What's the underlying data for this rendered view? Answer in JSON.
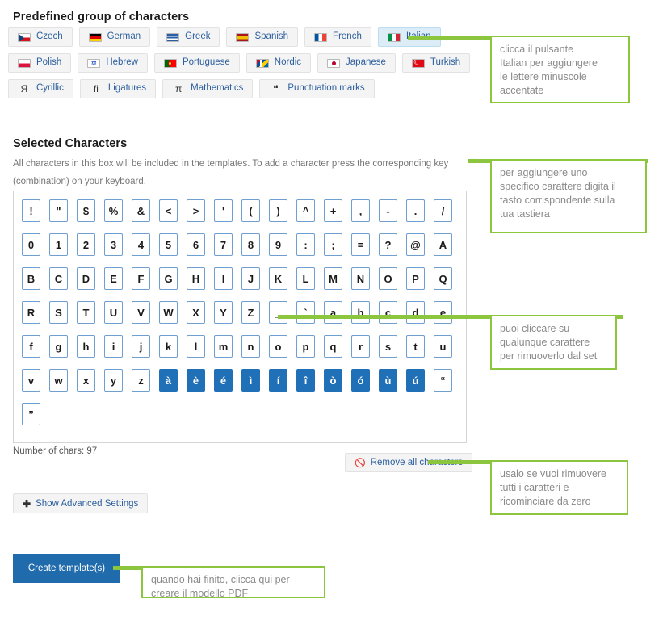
{
  "predefined": {
    "title": "Predefined group of characters",
    "rows": [
      [
        {
          "label": "Czech",
          "icon": "flag-czech-icon",
          "flag": "f-cz",
          "selected": false
        },
        {
          "label": "German",
          "icon": "flag-german-icon",
          "flag": "f-de",
          "selected": false
        },
        {
          "label": "Greek",
          "icon": "flag-greek-icon",
          "flag": "f-gr",
          "selected": false
        },
        {
          "label": "Spanish",
          "icon": "flag-spanish-icon",
          "flag": "f-es",
          "selected": false
        },
        {
          "label": "French",
          "icon": "flag-french-icon",
          "flag": "f-fr",
          "selected": false
        },
        {
          "label": "Italian",
          "icon": "flag-italian-icon",
          "flag": "f-it",
          "selected": true
        }
      ],
      [
        {
          "label": "Polish",
          "icon": "flag-polish-icon",
          "flag": "f-pl",
          "selected": false
        },
        {
          "label": "Hebrew",
          "icon": "flag-hebrew-icon",
          "flag": "f-il",
          "selected": false
        },
        {
          "label": "Portuguese",
          "icon": "flag-portuguese-icon",
          "flag": "f-pt",
          "selected": false
        },
        {
          "label": "Nordic",
          "icon": "flag-nordic-icon",
          "flag": "f-nordic",
          "selected": false
        },
        {
          "label": "Japanese",
          "icon": "flag-japanese-icon",
          "flag": "f-jp",
          "selected": false
        },
        {
          "label": "Turkish",
          "icon": "flag-turkish-icon",
          "flag": "f-tr",
          "selected": false
        }
      ],
      [
        {
          "label": "Cyrillic",
          "icon": "cyrillic-ya-icon",
          "glyph": "Я",
          "selected": false
        },
        {
          "label": "Ligatures",
          "icon": "ligature-fi-icon",
          "glyph": "ﬁ",
          "selected": false
        },
        {
          "label": "Mathematics",
          "icon": "pi-icon",
          "glyph": "π",
          "selected": false
        },
        {
          "label": "Punctuation marks",
          "icon": "quote-marks-icon",
          "glyph": "❝",
          "selected": false
        }
      ]
    ]
  },
  "selected_characters": {
    "title": "Selected Characters",
    "help_text": "All characters in this box will be included in the templates. To add a character press the corresponding key (combination) on your keyboard.",
    "count_label": "Number of chars: 97",
    "rows": [
      [
        {
          "ch": "!",
          "hl": false
        },
        {
          "ch": "\"",
          "hl": false
        },
        {
          "ch": "$",
          "hl": false
        },
        {
          "ch": "%",
          "hl": false
        },
        {
          "ch": "&",
          "hl": false
        },
        {
          "ch": "<",
          "hl": false
        },
        {
          "ch": ">",
          "hl": false
        },
        {
          "ch": "'",
          "hl": false
        },
        {
          "ch": "(",
          "hl": false
        },
        {
          "ch": ")",
          "hl": false
        },
        {
          "ch": "^",
          "hl": false
        },
        {
          "ch": "+",
          "hl": false
        },
        {
          "ch": ",",
          "hl": false
        },
        {
          "ch": "-",
          "hl": false
        },
        {
          "ch": ".",
          "hl": false
        },
        {
          "ch": "/",
          "hl": false
        }
      ],
      [
        {
          "ch": "0",
          "hl": false
        },
        {
          "ch": "1",
          "hl": false
        },
        {
          "ch": "2",
          "hl": false
        },
        {
          "ch": "3",
          "hl": false
        },
        {
          "ch": "4",
          "hl": false
        },
        {
          "ch": "5",
          "hl": false
        },
        {
          "ch": "6",
          "hl": false
        },
        {
          "ch": "7",
          "hl": false
        },
        {
          "ch": "8",
          "hl": false
        },
        {
          "ch": "9",
          "hl": false
        },
        {
          "ch": ":",
          "hl": false
        },
        {
          "ch": ";",
          "hl": false
        },
        {
          "ch": "=",
          "hl": false
        },
        {
          "ch": "?",
          "hl": false
        },
        {
          "ch": "@",
          "hl": false
        },
        {
          "ch": "A",
          "hl": false
        }
      ],
      [
        {
          "ch": "B",
          "hl": false
        },
        {
          "ch": "C",
          "hl": false
        },
        {
          "ch": "D",
          "hl": false
        },
        {
          "ch": "E",
          "hl": false
        },
        {
          "ch": "F",
          "hl": false
        },
        {
          "ch": "G",
          "hl": false
        },
        {
          "ch": "H",
          "hl": false
        },
        {
          "ch": "I",
          "hl": false
        },
        {
          "ch": "J",
          "hl": false
        },
        {
          "ch": "K",
          "hl": false
        },
        {
          "ch": "L",
          "hl": false
        },
        {
          "ch": "M",
          "hl": false
        },
        {
          "ch": "N",
          "hl": false
        },
        {
          "ch": "O",
          "hl": false
        },
        {
          "ch": "P",
          "hl": false
        },
        {
          "ch": "Q",
          "hl": false
        }
      ],
      [
        {
          "ch": "R",
          "hl": false
        },
        {
          "ch": "S",
          "hl": false
        },
        {
          "ch": "T",
          "hl": false
        },
        {
          "ch": "U",
          "hl": false
        },
        {
          "ch": "V",
          "hl": false
        },
        {
          "ch": "W",
          "hl": false
        },
        {
          "ch": "X",
          "hl": false
        },
        {
          "ch": "Y",
          "hl": false
        },
        {
          "ch": "Z",
          "hl": false
        },
        {
          "ch": "_",
          "hl": false
        },
        {
          "ch": "`",
          "hl": false
        },
        {
          "ch": "a",
          "hl": false
        },
        {
          "ch": "b",
          "hl": false
        },
        {
          "ch": "c",
          "hl": false
        },
        {
          "ch": "d",
          "hl": false
        },
        {
          "ch": "e",
          "hl": false
        }
      ],
      [
        {
          "ch": "f",
          "hl": false
        },
        {
          "ch": "g",
          "hl": false
        },
        {
          "ch": "h",
          "hl": false
        },
        {
          "ch": "i",
          "hl": false
        },
        {
          "ch": "j",
          "hl": false
        },
        {
          "ch": "k",
          "hl": false
        },
        {
          "ch": "l",
          "hl": false
        },
        {
          "ch": "m",
          "hl": false
        },
        {
          "ch": "n",
          "hl": false
        },
        {
          "ch": "o",
          "hl": false
        },
        {
          "ch": "p",
          "hl": false
        },
        {
          "ch": "q",
          "hl": false
        },
        {
          "ch": "r",
          "hl": false
        },
        {
          "ch": "s",
          "hl": false
        },
        {
          "ch": "t",
          "hl": false
        },
        {
          "ch": "u",
          "hl": false
        }
      ],
      [
        {
          "ch": "v",
          "hl": false
        },
        {
          "ch": "w",
          "hl": false
        },
        {
          "ch": "x",
          "hl": false
        },
        {
          "ch": "y",
          "hl": false
        },
        {
          "ch": "z",
          "hl": false
        },
        {
          "ch": "à",
          "hl": true
        },
        {
          "ch": "è",
          "hl": true
        },
        {
          "ch": "é",
          "hl": true
        },
        {
          "ch": "ì",
          "hl": true
        },
        {
          "ch": "í",
          "hl": true
        },
        {
          "ch": "î",
          "hl": true
        },
        {
          "ch": "ò",
          "hl": true
        },
        {
          "ch": "ó",
          "hl": true
        },
        {
          "ch": "ù",
          "hl": true
        },
        {
          "ch": "ú",
          "hl": true
        },
        {
          "ch": "“",
          "hl": false
        }
      ],
      [
        {
          "ch": "”",
          "hl": false
        }
      ]
    ]
  },
  "actions": {
    "remove_all_label": "Remove all characters",
    "remove_all_icon": "ban-icon",
    "advanced_label": "Show Advanced Settings",
    "advanced_icon": "plus-icon",
    "create_label": "Create template(s)"
  },
  "annotations": [
    {
      "id": "anno-italian",
      "text": "clicca il pulsante\nItalian per aggiungere\nle lettere minuscole\naccentate"
    },
    {
      "id": "anno-keyboard",
      "text": "per aggiungere uno\nspecifico carattere digita il\ntasto corrispondente sulla\ntua tastiera"
    },
    {
      "id": "anno-remove-char",
      "text": "puoi cliccare su\nqualunque carattere\nper rimuoverlo dal set"
    },
    {
      "id": "anno-remove-all",
      "text": "usalo se vuoi rimuovere\ntutti i caratteri e\nricominciare da zero"
    },
    {
      "id": "anno-create",
      "text": "quando hai finito, clicca qui per\ncreare il modello PDF"
    }
  ],
  "colors": {
    "annotation_green": "#8cc63e",
    "link_blue": "#2c5f9e",
    "primary_blue": "#1f6bab",
    "key_highlight": "#2070b8"
  }
}
